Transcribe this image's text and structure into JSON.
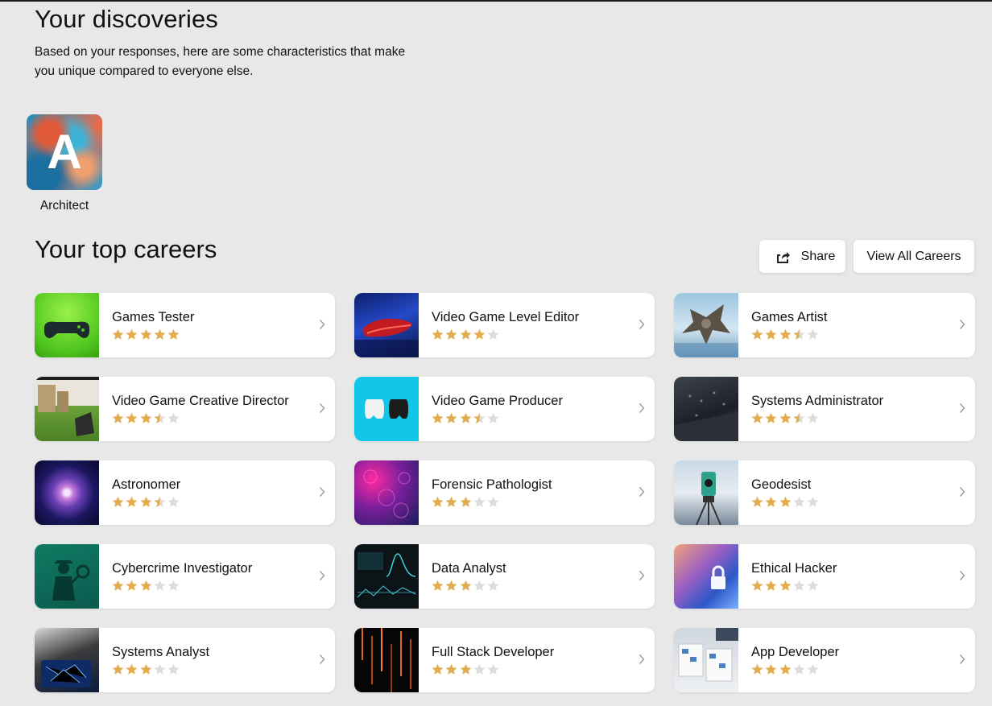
{
  "discoveries": {
    "title": "Your discoveries",
    "description": "Based on your responses, here are some characteristics that make you unique compared to everyone else.",
    "items": [
      {
        "letter": "A",
        "label": "Architect"
      }
    ]
  },
  "careers": {
    "title": "Your top careers",
    "share_label": "Share",
    "view_all_label": "View All Careers",
    "colors": {
      "star_filled": "#e2ad4f",
      "star_empty": "#dcdcdc"
    },
    "items": [
      {
        "title": "Games Tester",
        "rating": 5,
        "image": "gamepad-green"
      },
      {
        "title": "Video Game Level Editor",
        "rating": 4,
        "image": "red-mouse"
      },
      {
        "title": "Games Artist",
        "rating": 3.5,
        "image": "game-robot"
      },
      {
        "title": "Video Game Creative Director",
        "rating": 3.5,
        "image": "game-scene"
      },
      {
        "title": "Video Game Producer",
        "rating": 3.5,
        "image": "controllers-cyan"
      },
      {
        "title": "Systems Administrator",
        "rating": 3.5,
        "image": "server-lights"
      },
      {
        "title": "Astronomer",
        "rating": 3.5,
        "image": "galaxy"
      },
      {
        "title": "Forensic Pathologist",
        "rating": 3,
        "image": "cells-purple"
      },
      {
        "title": "Geodesist",
        "rating": 3,
        "image": "survey-instrument"
      },
      {
        "title": "Cybercrime Investigator",
        "rating": 3,
        "image": "detective-green"
      },
      {
        "title": "Data Analyst",
        "rating": 3,
        "image": "data-dashboard"
      },
      {
        "title": "Ethical Hacker",
        "rating": 3,
        "image": "lock-blue"
      },
      {
        "title": "Systems Analyst",
        "rating": 3,
        "image": "network-tablet"
      },
      {
        "title": "Full Stack Developer",
        "rating": 3,
        "image": "code-rain"
      },
      {
        "title": "App Developer",
        "rating": 3,
        "image": "wireframes-desk"
      }
    ]
  }
}
